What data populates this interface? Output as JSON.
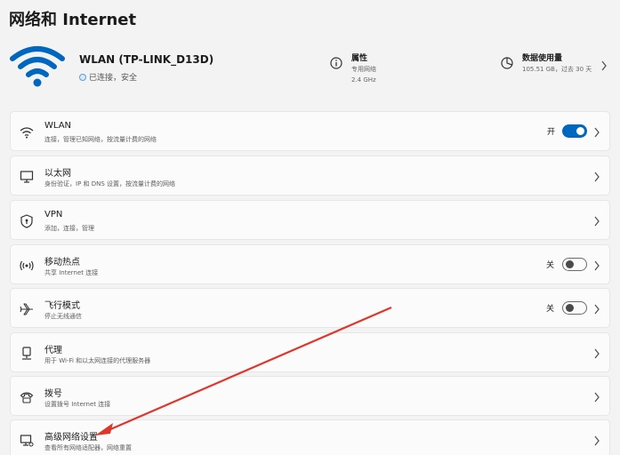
{
  "page_title": "网络和 Internet",
  "connection": {
    "name": "WLAN (TP-LINK_D13D)",
    "status": "已连接，安全"
  },
  "properties": {
    "title": "属性",
    "line1": "专用网络",
    "line2": "2.4 GHz"
  },
  "data_usage": {
    "title": "数据使用量",
    "detail": "105.51 GB，过去 30 天"
  },
  "items": [
    {
      "title": "WLAN",
      "subtitle": "连接，管理已知网络，按流量计费的网络",
      "toggle_label": "开",
      "toggle_state": "on",
      "icon": "wifi-icon"
    },
    {
      "title": "以太网",
      "subtitle": "身份验证，IP 和 DNS 设置，按流量计费的网络",
      "icon": "ethernet-icon"
    },
    {
      "title": "VPN",
      "subtitle": "添加，连接，管理",
      "icon": "shield-icon"
    },
    {
      "title": "移动热点",
      "subtitle": "共享 Internet 连接",
      "toggle_label": "关",
      "toggle_state": "off",
      "icon": "hotspot-icon"
    },
    {
      "title": "飞行模式",
      "subtitle": "停止无线通信",
      "toggle_label": "关",
      "toggle_state": "off",
      "icon": "airplane-icon"
    },
    {
      "title": "代理",
      "subtitle": "用于 Wi-Fi 和以太网连接的代理服务器",
      "icon": "proxy-icon"
    },
    {
      "title": "拨号",
      "subtitle": "设置拨号 Internet 连接",
      "icon": "dialup-icon"
    },
    {
      "title": "高级网络设置",
      "subtitle": "查看所有网络适配器，网络重置",
      "icon": "advanced-network-icon"
    }
  ],
  "colors": {
    "accent": "#0067c0",
    "annotation_arrow": "#e0352b"
  }
}
